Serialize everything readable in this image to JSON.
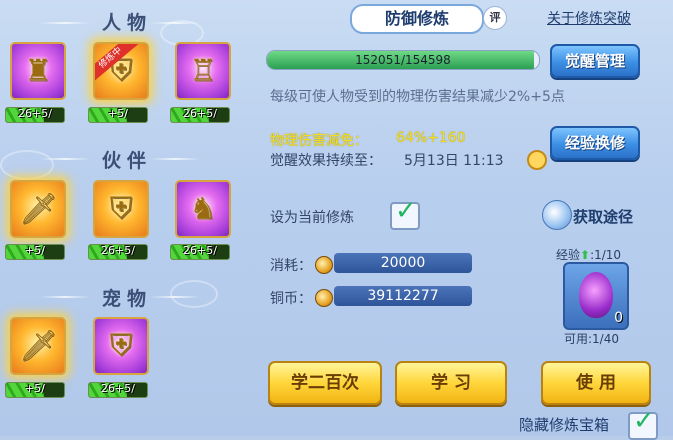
{
  "sections": {
    "person": "人物",
    "partner": "伙伴",
    "pet": "宠物"
  },
  "person_icons": [
    {
      "level": "26+5/",
      "progress": 0.65
    },
    {
      "badge": "修炼中",
      "level": "+5/",
      "progress": 0.65
    },
    {
      "level": "26+5/",
      "progress": 0.65
    }
  ],
  "partner_icons": [
    {
      "level": "+5/",
      "progress": 0.65
    },
    {
      "level": "26+5/",
      "progress": 0.65
    },
    {
      "level": "26+5/",
      "progress": 0.65
    }
  ],
  "pet_icons": [
    {
      "level": "+5/",
      "progress": 0.65
    },
    {
      "level": "26+5/",
      "progress": 0.65
    }
  ],
  "header": {
    "title": "防御修炼",
    "rate_label": "评",
    "about_link": "关于修炼突破"
  },
  "exp": {
    "text": "152051/154598",
    "progress": 0.98,
    "awaken_button": "觉醒管理"
  },
  "description": "每级可使人物受到的物理伤害结果减少2%+5点",
  "reduction": {
    "label": "物理伤害减免：",
    "value": "64%+160",
    "exchange_button": "经验换修"
  },
  "duration": {
    "label": "觉醒效果持续至：",
    "value": "5月13日 11:13"
  },
  "current": {
    "label": "设为当前修炼",
    "checked": true,
    "get_path": "获取途径"
  },
  "cost": {
    "label": "消耗：",
    "value": "20000"
  },
  "copper": {
    "label": "铜币：",
    "value": "39112277"
  },
  "item": {
    "exp_label": "经验",
    "exp_count": ":1/10",
    "count": "0",
    "usable": "可用:1/40"
  },
  "buttons": {
    "learn_hundred": "学二百次",
    "learn": "学 习",
    "use": "使 用"
  },
  "hide_box": {
    "label": "隐藏修炼宝箱",
    "checked": true
  },
  "colors": {
    "accent_blue": "#3c8fe4",
    "gold_button": "#ffd63b",
    "exp_green": "#2c9f53",
    "highlight_yellow": "#f5df1f"
  }
}
